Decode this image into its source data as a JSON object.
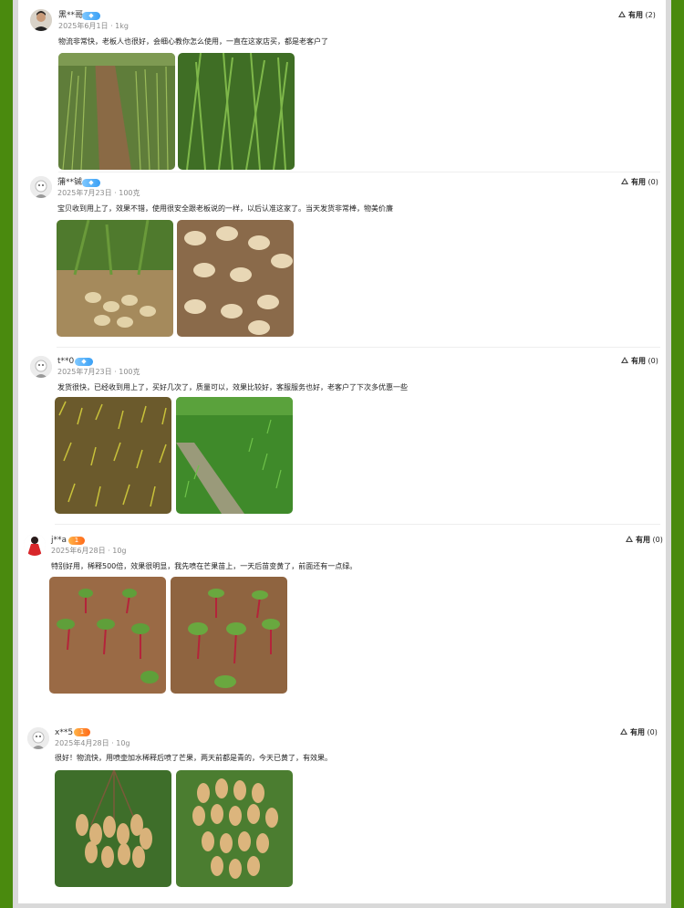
{
  "reviews": [
    {
      "username": "黑**哥",
      "badge_type": "diamond",
      "meta": "2025年6月1日 · 1kg",
      "text": "物流非常快，老板人也很好，会细心教你怎么使用，一直在这家店买，都是老客户了",
      "helpful_label": "有用",
      "helpful_count": "(2)",
      "avatar": "man-photo-avatar",
      "photos": [
        "wheat-field-rows-photo",
        "green-wheat-closeup-photo"
      ]
    },
    {
      "username": "蒲**铖",
      "badge_type": "diamond",
      "meta": "2025年7月23日 · 100克",
      "text": "宝贝收到用上了，效果不错，使用很安全跟老板说的一样，以后认准这家了。当天发货非常棒，物美价廉",
      "helpful_label": "有用",
      "helpful_count": "(0)",
      "avatar": "default-user-avatar",
      "photos": [
        "peanut-plant-roots-photo",
        "harvested-peanuts-photo"
      ]
    },
    {
      "username": "t**0",
      "badge_type": "diamond",
      "meta": "2025年7月23日 · 100克",
      "text": "发货很快，已经收到用上了，买好几次了，质量可以，效果比较好，客服服务也好，老客户了下次多优惠一些",
      "helpful_label": "有用",
      "helpful_count": "(0)",
      "avatar": "default-user-avatar",
      "photos": [
        "yellowing-seedlings-photo",
        "green-seedling-field-photo"
      ]
    },
    {
      "username": "j**a",
      "badge_type": "level",
      "badge_text": "1",
      "meta": "2025年6月28日 · 10g",
      "text": "特别好用，稀释500倍，效果很明显，我先喷在芒果苗上，一天后苗变黄了，前面还有一点绿。",
      "helpful_label": "有用",
      "helpful_count": "(0)",
      "avatar": "red-figure-avatar",
      "photos": [
        "beet-seedlings-photo",
        "beet-seedlings-rows-photo"
      ]
    },
    {
      "username": "x**5",
      "badge_type": "level",
      "badge_text": "1",
      "meta": "2025年4月28日 · 10g",
      "text": "很好！物流快，用喷壶加水稀释后喷了芒果，两天前都是青的，今天已黄了，有效果。",
      "helpful_label": "有用",
      "helpful_count": "(0)",
      "avatar": "default-user-avatar",
      "photos": [
        "peanut-bunch-photo",
        "peanut-cluster-photo"
      ]
    }
  ],
  "colors": {
    "outer_green": "#4a8a0e",
    "meta_gray": "#8a8a8a",
    "diamond_badge": "#3aa0f5",
    "level_badge": "#ff6a1a"
  }
}
